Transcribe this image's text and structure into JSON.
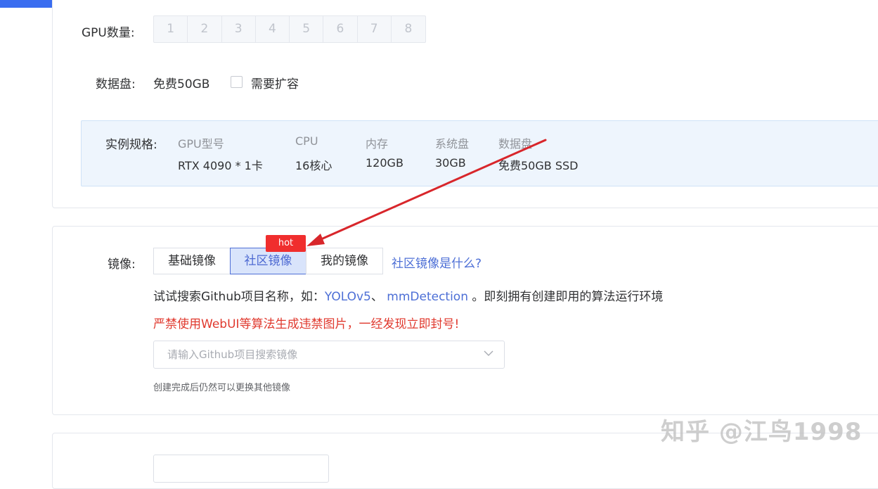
{
  "gpu_count": {
    "label": "GPU数量:",
    "options": [
      "1",
      "2",
      "3",
      "4",
      "5",
      "6",
      "7",
      "8"
    ]
  },
  "data_disk": {
    "label": "数据盘:",
    "free_text": "免费50GB",
    "expand_label": "需要扩容"
  },
  "spec": {
    "label": "实例规格:",
    "columns": [
      {
        "head": "GPU型号",
        "value": "RTX 4090 * 1卡"
      },
      {
        "head": "CPU",
        "value": "16核心"
      },
      {
        "head": "内存",
        "value": "120GB"
      },
      {
        "head": "系统盘",
        "value": "30GB"
      },
      {
        "head": "数据盘",
        "value": "免费50GB SSD"
      }
    ]
  },
  "image": {
    "label": "镜像:",
    "tabs": [
      {
        "label": "基础镜像"
      },
      {
        "label": "社区镜像"
      },
      {
        "label": "我的镜像"
      }
    ],
    "hot_badge": "hot",
    "what_link": "社区镜像是什么?",
    "hint_prefix": "试试搜索Github项目名称，如：",
    "hint_link1": "YOLOv5",
    "hint_sep": "、 ",
    "hint_link2": "mmDetection",
    "hint_suffix": " 。即刻拥有创建即用的算法运行环境",
    "warning": "严禁使用WebUI等算法生成违禁图片，一经发现立即封号!",
    "search_placeholder": "请输入Github项目搜索镜像",
    "note": "创建完成后仍然可以更换其他镜像"
  },
  "watermark": "知乎 @江鸟1998",
  "colors": {
    "accent": "#4d6fd6",
    "warning": "#e0392e",
    "hot": "#f02e2e",
    "annotation_arrow": "#d8262b",
    "topbar": "#3a6df0"
  }
}
